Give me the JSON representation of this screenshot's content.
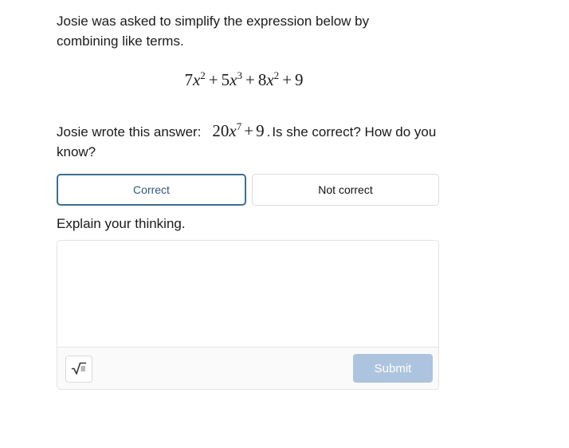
{
  "clipped_top_fragment": ".",
  "prompt": {
    "text": "Josie was asked to simplify the expression below by combining like terms."
  },
  "expression": {
    "term1_coef": "7",
    "term1_var": "x",
    "term1_exp": "2",
    "op1": "+",
    "term2_coef": "5",
    "term2_var": "x",
    "term2_exp": "3",
    "op2": "+",
    "term3_coef": "8",
    "term3_var": "x",
    "term3_exp": "2",
    "op3": "+",
    "term4": "9",
    "plain": "7x^2 + 5x^3 + 8x^2 + 9"
  },
  "answer_line": {
    "lead_text": "Josie wrote this answer:",
    "student_answer": {
      "coef": "20",
      "var": "x",
      "exp": "7",
      "op": "+",
      "constant": "9",
      "plain": "20x^7 + 9"
    },
    "period": ".",
    "follow_text": "Is she correct? How do you know?"
  },
  "choices": {
    "selected_index": 0,
    "options": [
      {
        "label": "Correct",
        "selected": true
      },
      {
        "label": "Not correct",
        "selected": false
      }
    ]
  },
  "explain": {
    "label": "Explain your thinking.",
    "textarea_value": "",
    "textarea_placeholder": ""
  },
  "toolbar": {
    "math_tool_icon": "square-root-icon",
    "submit_label": "Submit",
    "submit_enabled": false
  },
  "colors": {
    "selected_border": "#3d6e8f",
    "selected_text": "#2c5a7c",
    "unselected_border": "#dcdcdc",
    "card_border": "#e2e2e2",
    "toolbar_bg": "#fafafa",
    "submit_bg": "#adc4de",
    "submit_text": "#ffffff",
    "body_text": "#1a1a1a"
  }
}
